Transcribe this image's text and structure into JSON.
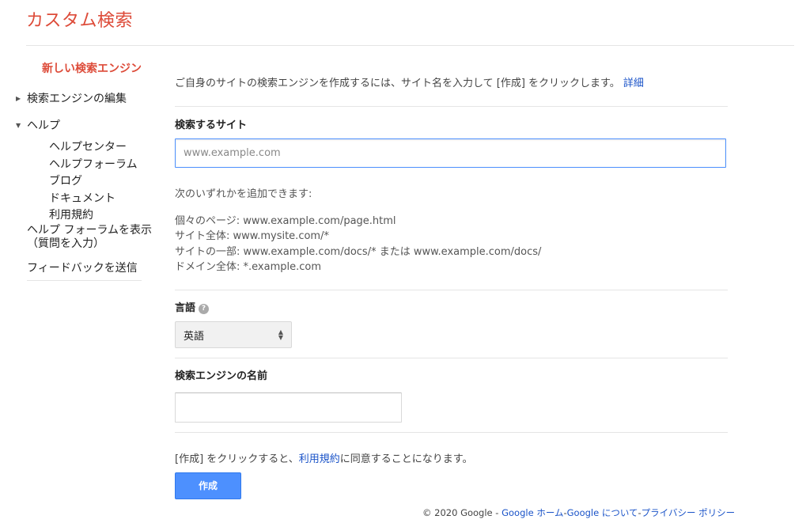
{
  "app": {
    "title": "カスタム検索"
  },
  "sidebar": {
    "new_engine": "新しい検索エンジン",
    "edit_engine": "検索エンジンの編集",
    "help": "ヘルプ",
    "help_items": [
      "ヘルプセンター",
      "ヘルプフォーラム",
      "ブログ",
      "ドキュメント",
      "利用規約"
    ],
    "forum_line1": "ヘルプ フォーラムを表示",
    "forum_line2": "（質問を入力）",
    "feedback": "フィードバックを送信"
  },
  "main": {
    "intro": "ご自身のサイトの検索エンジンを作成するには、サイト名を入力して [作成] をクリックします。",
    "intro_link": "詳細",
    "site_label": "検索するサイト",
    "site_placeholder": "www.example.com",
    "site_value": "",
    "hints_title": "次のいずれかを追加できます:",
    "hints": [
      "個々のページ: www.example.com/page.html",
      "サイト全体: www.mysite.com/*",
      "サイトの一部: www.example.com/docs/* または www.example.com/docs/",
      "ドメイン全体: *.example.com"
    ],
    "language_label": "言語",
    "language_value": "英語",
    "name_label": "検索エンジンの名前",
    "name_value": "",
    "agree_prefix": "[作成] をクリックすると、",
    "agree_link": "利用規約",
    "agree_suffix": "に同意することになります。",
    "create_button": "作成"
  },
  "footer": {
    "copyright": "© 2020 Google",
    "sep": "-",
    "links": [
      "Google ホーム",
      "Google について",
      "プライバシー ポリシー"
    ]
  },
  "colors": {
    "brand_red": "#dd4b39",
    "link_blue": "#1a53c8",
    "button_blue": "#4d90fe"
  },
  "icons": {
    "collapsed": "triangle-right-icon",
    "expanded": "triangle-down-icon",
    "help": "question-circle-icon",
    "select": "updown-arrows-icon"
  }
}
